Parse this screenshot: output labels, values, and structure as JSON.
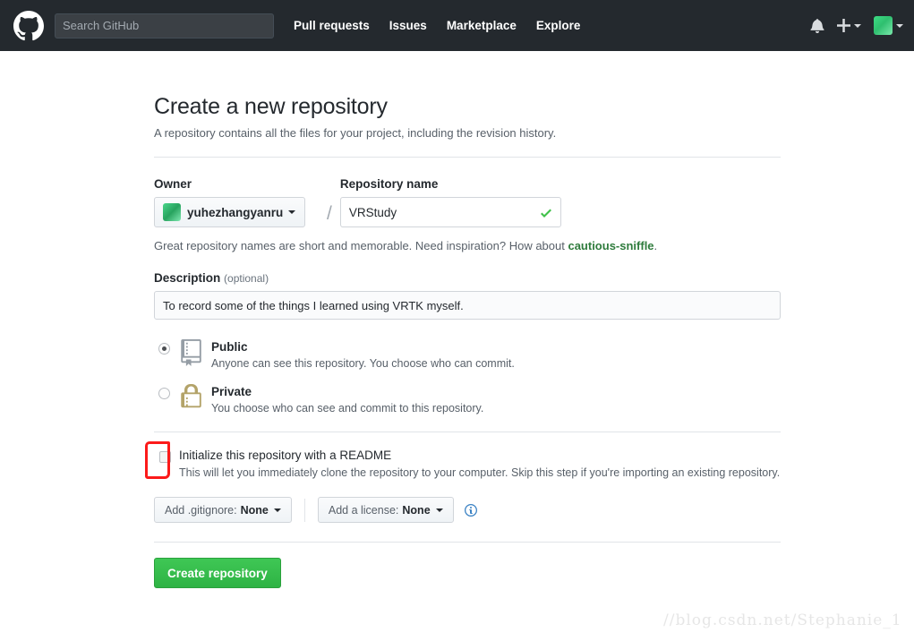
{
  "header": {
    "logo_icon": "github-octocat-icon",
    "search": {
      "placeholder": "Search GitHub",
      "value": ""
    },
    "nav": [
      {
        "label": "Pull requests"
      },
      {
        "label": "Issues"
      },
      {
        "label": "Marketplace"
      },
      {
        "label": "Explore"
      }
    ],
    "notifications_icon": "bell-icon",
    "create_new_icon": "plus-icon",
    "avatar_icon": "user-avatar",
    "background_color": "#24292e"
  },
  "main": {
    "title": "Create a new repository",
    "subtitle": "A repository contains all the files for your project, including the revision history.",
    "owner": {
      "label": "Owner",
      "name": "yuhezhangyanru",
      "avatar_icon": "owner-avatar"
    },
    "separator": "/",
    "repository": {
      "label": "Repository name",
      "value": "VRStudy",
      "valid_icon": "green-check-icon",
      "valid_color": "#40c14a"
    },
    "hint": {
      "text": "Great repository names are short and memorable. Need inspiration? How about ",
      "suggestion": "cautious-sniffle",
      "suffix": "."
    },
    "description": {
      "label": "Description",
      "optional_label": "(optional)",
      "value": "To record some of the things I learned using VRTK myself.",
      "placeholder": ""
    },
    "visibility": [
      {
        "id": "public",
        "title": "Public",
        "description": "Anyone can see this repository. You choose who can commit.",
        "selected": true,
        "icon": "repo-book-icon",
        "icon_color": "#959da5"
      },
      {
        "id": "private",
        "title": "Private",
        "description": "You choose who can see and commit to this repository.",
        "selected": false,
        "icon": "lock-icon",
        "icon_color": "#b3a369"
      }
    ],
    "readme": {
      "title": "Initialize this repository with a README",
      "description": "This will let you immediately clone the repository to your computer. Skip this step if you're importing an existing repository.",
      "checked": false,
      "annotation_color": "#fc1a1a"
    },
    "gitignore": {
      "label": "Add .gitignore:",
      "value": "None"
    },
    "license": {
      "label": "Add a license:",
      "value": "None"
    },
    "info_icon": "info-circle-icon",
    "submit": {
      "label": "Create repository",
      "color": "#2eb344"
    }
  },
  "watermark": {
    "text": "//blog.csdn.net/Stephanie_1"
  }
}
